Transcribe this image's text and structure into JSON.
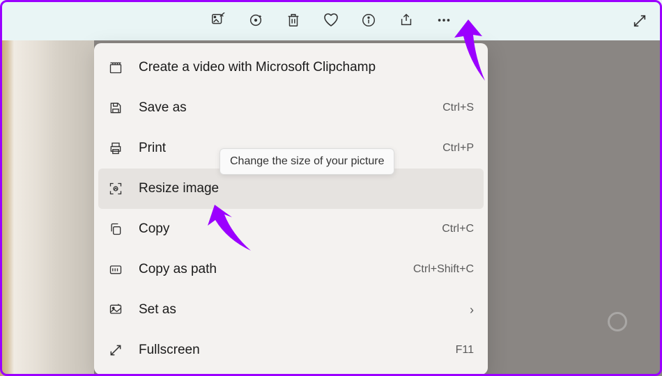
{
  "toolbar": {
    "icons": [
      "edit",
      "rotate",
      "delete",
      "favorite",
      "info",
      "share",
      "more"
    ]
  },
  "menu": {
    "items": [
      {
        "icon": "clipchamp",
        "label": "Create a video with Microsoft Clipchamp",
        "shortcut": "",
        "submenu": false
      },
      {
        "icon": "save",
        "label": "Save as",
        "shortcut": "Ctrl+S",
        "submenu": false
      },
      {
        "icon": "print",
        "label": "Print",
        "shortcut": "Ctrl+P",
        "submenu": false
      },
      {
        "icon": "resize",
        "label": "Resize image",
        "shortcut": "",
        "submenu": false,
        "highlighted": true
      },
      {
        "icon": "copy",
        "label": "Copy",
        "shortcut": "Ctrl+C",
        "submenu": false
      },
      {
        "icon": "copypath",
        "label": "Copy as path",
        "shortcut": "Ctrl+Shift+C",
        "submenu": false
      },
      {
        "icon": "setas",
        "label": "Set as",
        "shortcut": "",
        "submenu": true
      },
      {
        "icon": "fullscreen",
        "label": "Fullscreen",
        "shortcut": "F11",
        "submenu": false
      }
    ]
  },
  "tooltip": {
    "text": "Change the size of your picture"
  }
}
